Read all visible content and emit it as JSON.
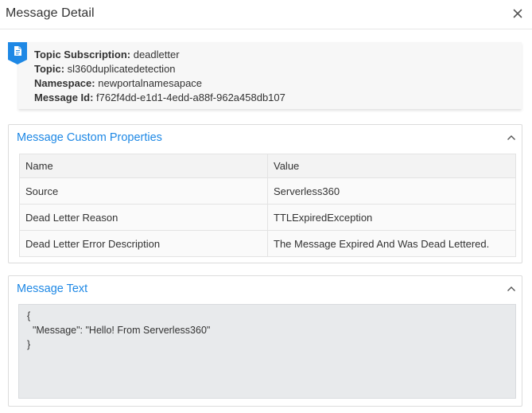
{
  "header": {
    "title": "Message Detail",
    "close_icon": "close-icon"
  },
  "info": {
    "badge_icon": "document-icon",
    "topic_subscription_label": "Topic Subscription:",
    "topic_subscription_value": "deadletter",
    "topic_label": "Topic:",
    "topic_value": "sl360duplicatedetection",
    "namespace_label": "Namespace:",
    "namespace_value": "newportalnamesapace",
    "message_id_label": "Message Id:",
    "message_id_value": "f762f4dd-e1d1-4edd-a88f-962a458db107"
  },
  "custom_properties": {
    "title": "Message Custom Properties",
    "columns": [
      "Name",
      "Value"
    ],
    "rows": [
      {
        "name": "Source",
        "value": "Serverless360"
      },
      {
        "name": "Dead Letter Reason",
        "value": "TTLExpiredException"
      },
      {
        "name": "Dead Letter Error Description",
        "value": "The Message Expired And Was Dead Lettered."
      }
    ]
  },
  "message_text": {
    "title": "Message Text",
    "lines": [
      "{",
      "  \"Message\": \"Hello! From Serverless360\"",
      "}"
    ]
  },
  "colors": {
    "accent": "#1e88e5",
    "badge": "#1e88e5"
  }
}
